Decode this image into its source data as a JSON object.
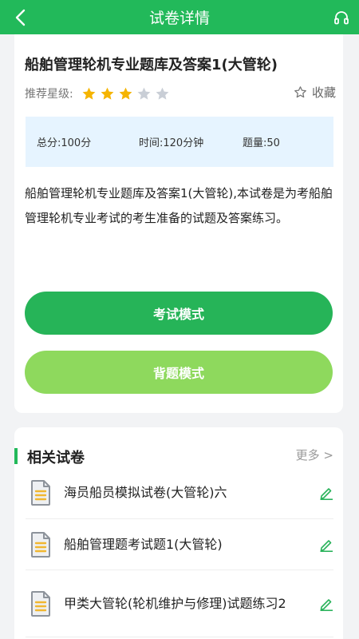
{
  "header": {
    "title": "试卷详情",
    "back_icon": "chevron-left-icon",
    "audio_icon": "headphones-icon"
  },
  "paper": {
    "title": "船舶管理轮机专业题库及答案1(大管轮)",
    "rating_label": "推荐星级:",
    "rating": 3,
    "rating_max": 5,
    "favorite_label": "收藏",
    "score_label": "总分:100分",
    "time_label": "时间:120分钟",
    "count_label": "题量:50",
    "description": "船舶管理轮机专业题库及答案1(大管轮),本试卷是为考船舶管理轮机专业考试的考生准备的试题及答案练习。"
  },
  "buttons": {
    "exam": "考试模式",
    "recite": "背题模式"
  },
  "related": {
    "title": "相关试卷",
    "more": "更多 >",
    "items": [
      {
        "name": "海员船员模拟试卷(大管轮)六"
      },
      {
        "name": "船舶管理题考试题1(大管轮)"
      },
      {
        "name": "甲类大管轮(轮机维护与修理)试题练习2"
      }
    ]
  },
  "colors": {
    "primary": "#22b95a",
    "secondary_button": "#8ed95d",
    "star_on": "#f5b400",
    "star_off": "#c9ced6",
    "info_bg": "#e6f4ff"
  }
}
